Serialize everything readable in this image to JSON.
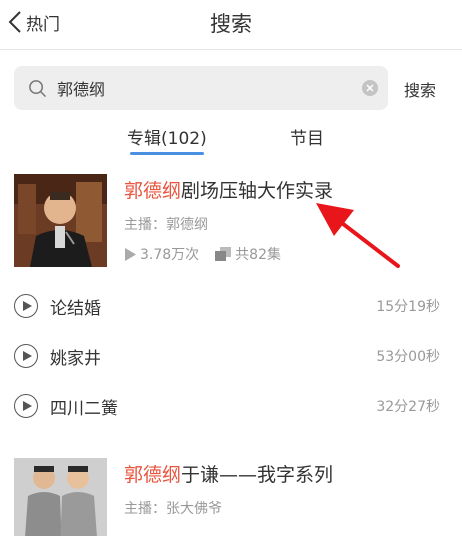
{
  "nav": {
    "back_label": "热门",
    "title": "搜索"
  },
  "search": {
    "query": "郭德纲",
    "submit_label": "搜索"
  },
  "tabs": [
    {
      "label": "专辑(102)",
      "active": true
    },
    {
      "label": "节目",
      "active": false
    }
  ],
  "albums": [
    {
      "title_highlight": "郭德纲",
      "title_rest": "剧场压轴大作实录",
      "host": "主播：郭德纲",
      "plays": "3.78万次",
      "episodes": "共82集"
    },
    {
      "title_highlight": "郭德纲",
      "title_rest": "于谦——我字系列",
      "host": "主播：张大佛爷"
    }
  ],
  "tracks": [
    {
      "name": "论结婚",
      "duration": "15分19秒"
    },
    {
      "name": "姚家井",
      "duration": "53分00秒"
    },
    {
      "name": "四川二簧",
      "duration": "32分27秒"
    }
  ],
  "colors": {
    "highlight": "#e8553e",
    "tab_underline": "#4a90e2",
    "annotation_arrow": "#e8161b"
  }
}
